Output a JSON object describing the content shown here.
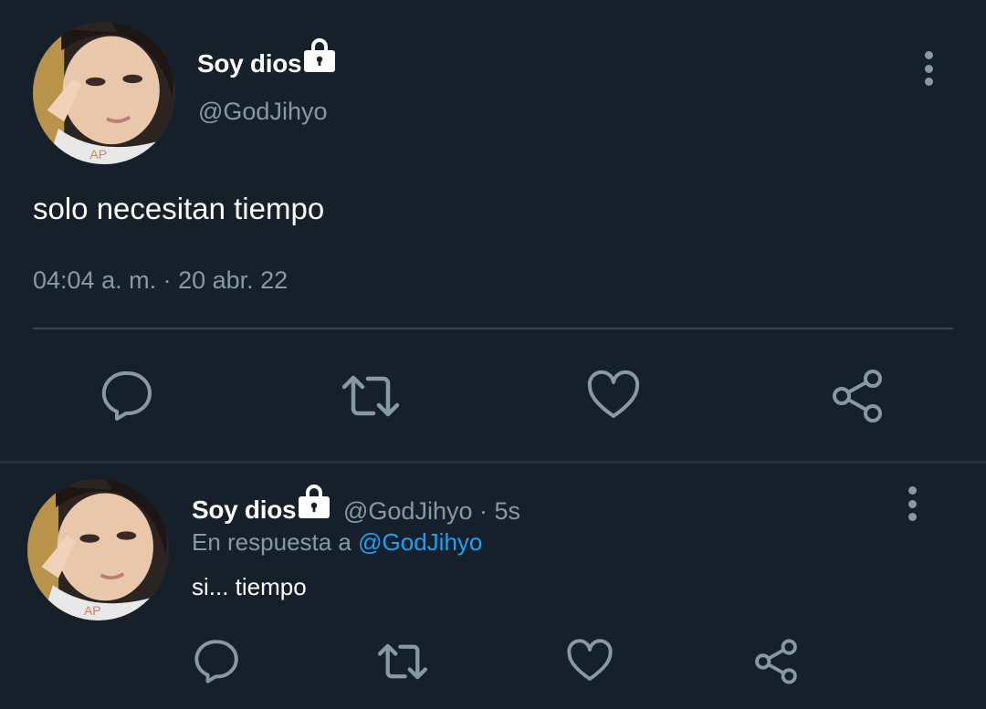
{
  "colors": {
    "background": "#15202b",
    "text_primary": "#ffffff",
    "text_secondary": "#8899a6",
    "mention": "#1da1f2",
    "divider": "#38444d"
  },
  "main_tweet": {
    "display_name": "Soy dios",
    "handle": "@GodJihyo",
    "text": "solo necesitan tiempo",
    "timestamp": "04:04 a. m. · 20 abr. 22",
    "icons": {
      "avatar": "profile-photo",
      "lock": "lock-icon",
      "more": "more-vertical-icon",
      "reply": "reply-icon",
      "retweet": "retweet-icon",
      "like": "heart-icon",
      "share": "share-icon"
    }
  },
  "reply_tweet": {
    "display_name": "Soy dios",
    "handle_time": "@GodJihyo · 5s",
    "replying_to_prefix": "En respuesta a",
    "replying_to_mention": "@GodJihyo",
    "text": "si... tiempo"
  }
}
